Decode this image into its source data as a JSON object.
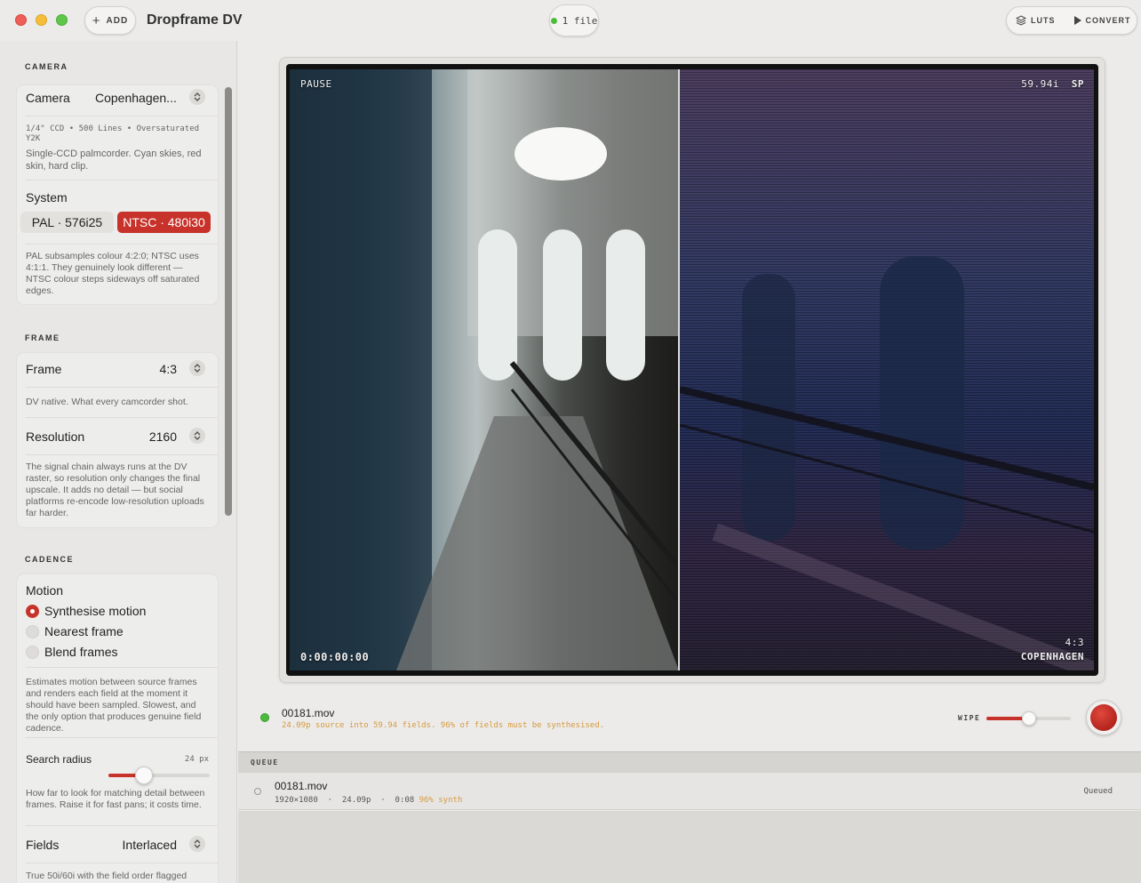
{
  "titlebar": {
    "add_label": "ADD",
    "app_title": "Dropframe DV",
    "file_count": "1 file",
    "luts_label": "LUTS",
    "convert_label": "CONVERT"
  },
  "sidebar": {
    "camera": {
      "section": "CAMERA",
      "label": "Camera",
      "value": "Copenhagen...",
      "spec": "1/4\" CCD • 500 Lines • Oversaturated Y2K",
      "description": "Single-CCD palmcorder. Cyan skies, red skin, hard clip.",
      "system_label": "System",
      "system_options": [
        "PAL · 576i25",
        "NTSC · 480i30"
      ],
      "system_selected": "NTSC · 480i30",
      "system_note": "PAL subsamples colour 4:2:0; NTSC uses 4:1:1. They genuinely look different — NTSC colour steps sideways off saturated edges."
    },
    "frame": {
      "section": "FRAME",
      "label": "Frame",
      "value": "4:3",
      "note": "DV native. What every camcorder shot.",
      "resolution_label": "Resolution",
      "resolution_value": "2160",
      "resolution_note": "The signal chain always runs at the DV raster, so resolution only changes the final upscale. It adds no detail — but social platforms re-encode low-resolution uploads far harder."
    },
    "cadence": {
      "section": "CADENCE",
      "motion_label": "Motion",
      "motion_options": [
        "Synthesise motion",
        "Nearest frame",
        "Blend frames"
      ],
      "motion_selected": "Synthesise motion",
      "motion_note": "Estimates motion between source frames and renders each field at the moment it should have been sampled. Slowest, and the only option that produces genuine field cadence.",
      "search_radius_label": "Search radius",
      "search_radius_value": "24 px",
      "search_radius_fraction": 0.35,
      "search_radius_note": "How far to look for matching detail between frames. Raise it for fast pans; it costs time.",
      "fields_label": "Fields",
      "fields_value": "Interlaced",
      "fields_note": "True 50i/60i with the field order flagged"
    }
  },
  "viewer": {
    "osd_state": "PAUSE",
    "osd_rate": "59.94i",
    "osd_speed": "SP",
    "osd_timecode": "0:00:00:00",
    "osd_aspect": "4:3",
    "osd_camera": "COPENHAGEN",
    "wipe_fraction": 0.48
  },
  "status": {
    "file": "00181.mov",
    "note": "24.09p source into 59.94 fields. 96% of fields must be synthesised.",
    "wipe_label": "WIPE",
    "wipe_value": 0.5
  },
  "queue": {
    "title": "QUEUE",
    "items": [
      {
        "name": "00181.mov",
        "resolution": "1920×1080",
        "fps": "24.09p",
        "duration": "0:08",
        "synth": "96% synth",
        "state": "Queued"
      }
    ]
  },
  "colors": {
    "accent": "#c7332b",
    "status_green": "#4cbb3c",
    "warning": "#d69a3c"
  }
}
